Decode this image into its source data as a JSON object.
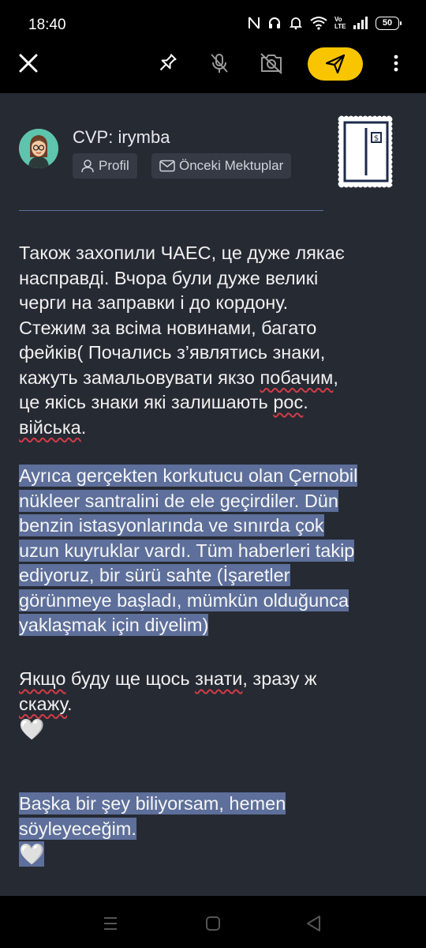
{
  "status_bar": {
    "time": "18:40",
    "battery": "50",
    "network": "Vo LTE"
  },
  "toolbar": {
    "close_icon": "close-icon",
    "pin_icon": "pin-icon",
    "mic_off_icon": "mic-off-icon",
    "camera_off_icon": "camera-off-icon",
    "send_icon": "send-icon",
    "more_icon": "more-vertical-icon",
    "accent": "#f8c500"
  },
  "message": {
    "sender": "CVP: irymba",
    "profile_label": "Profil",
    "previous_letters_label": "Önceki Mektuplar",
    "uk_para1": [
      "Також захопили ЧАЕС, це дуже лякає",
      "насправді. Вчора були дуже великі",
      "черги на заправки і до кордону.",
      "Стежим за всіма новинами, багато",
      "фейків( Почались з’являтись знаки,",
      "кажуть замальовувати якзо ",
      "побачим",
      ",",
      "це якісь знаки які залишають ",
      "рос",
      ".",
      "війська",
      "."
    ],
    "tr_para1": [
      "Ayrıca gerçekten korkutucu olan Çernobil",
      "nükleer santralini de ele geçirdiler. Dün",
      "benzin istasyonlarında ve sınırda çok",
      "uzun kuyruklar vardı. Tüm haberleri takip",
      "ediyoruz, bir sürü sahte (İşaretler",
      "görünmeye başladı, mümkün olduğunca",
      "yaklaşmak için diyelim)"
    ],
    "uk_para2": [
      "Якщо",
      " буду ще щось ",
      "знати",
      ", зразу ж",
      "скажу",
      "."
    ],
    "heart": "🤍",
    "tr_para2": [
      "Başka bir şey biliyorsam, hemen",
      "söyleyeceğim."
    ]
  },
  "colors": {
    "panel_bg": "#262a33",
    "highlight": "#5d6f9a",
    "spell_error": "#d23b47"
  }
}
